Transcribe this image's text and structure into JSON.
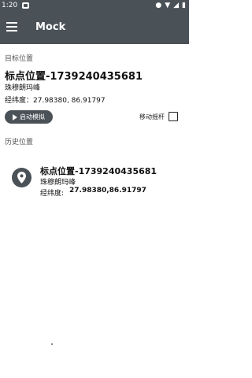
{
  "status_bar": {
    "time": "1:20",
    "icons": [
      "notification-icon",
      "location-icon",
      "wifi-icon",
      "signal-icon",
      "battery-icon"
    ]
  },
  "app_bar": {
    "title": "Mock",
    "menu_icon": "hamburger-menu-icon"
  },
  "target": {
    "section_label": "目标位置",
    "title": "标点位置-1739240435681",
    "name": "珠穆朗玛峰",
    "coords": "经纬度：27.98380, 86.91797"
  },
  "controls": {
    "start_button_label": "启动模拟",
    "joystick_label": "移动摇杆",
    "joystick_checked": false
  },
  "history": {
    "section_label": "历史位置",
    "items": [
      {
        "title": "标点位置-1739240435681",
        "name": "珠穆朗玛峰",
        "coords_label": "经纬度:",
        "coords_value": "27.98380,86.91797"
      }
    ]
  },
  "colors": {
    "primary": "#4a5157",
    "background": "#ffffff"
  }
}
